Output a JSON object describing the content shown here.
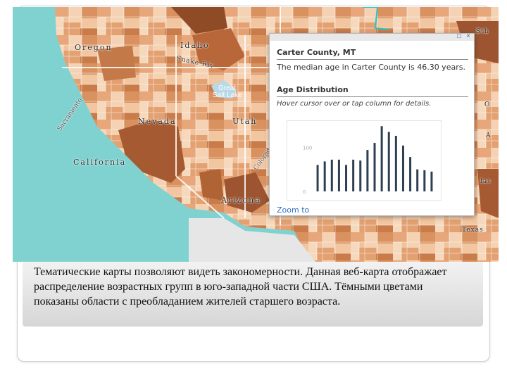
{
  "map": {
    "labels": {
      "oregon": "Oregon",
      "idaho": "Idaho",
      "nevada": "Nevada",
      "utah": "Utah",
      "california": "California",
      "arizona": "Arizona",
      "texas": "Texas",
      "great_salt_lake_1": "Great",
      "great_salt_lake_2": "Salt Lake",
      "snake_river": "Snake Riv",
      "sacramento_river": "Sacramento",
      "colorado_river": "Colorado River",
      "edge_sth": "Sth",
      "edge_o": "O",
      "edge_las": "las",
      "edge_a": "A"
    }
  },
  "popup": {
    "title": "Carter County, MT",
    "description": "The median age in Carter County is 46.30 years.",
    "subtitle": "Age Distribution",
    "hint": "Hover cursor over or tap column for details.",
    "zoom_link": "Zoom to",
    "controls": {
      "maximize": "□",
      "close": "×"
    },
    "chart_data": {
      "type": "bar",
      "title": "",
      "xlabel": "",
      "ylabel": "",
      "ylim": [
        0,
        150
      ],
      "y_ticks": [
        {
          "value": 0,
          "label": "0"
        },
        {
          "value": 100,
          "label": "100"
        }
      ],
      "values": [
        60,
        68,
        72,
        72,
        60,
        72,
        70,
        94,
        110,
        148,
        135,
        126,
        104,
        78,
        50,
        48,
        45
      ]
    }
  },
  "caption": {
    "text": "Тематические карты позволяют видеть закономерности. Данная веб-карта отображает распределение возрастных групп в юго-западной части США. Тёмными цветами показаны области с преобладанием жителей старшего возраста."
  }
}
